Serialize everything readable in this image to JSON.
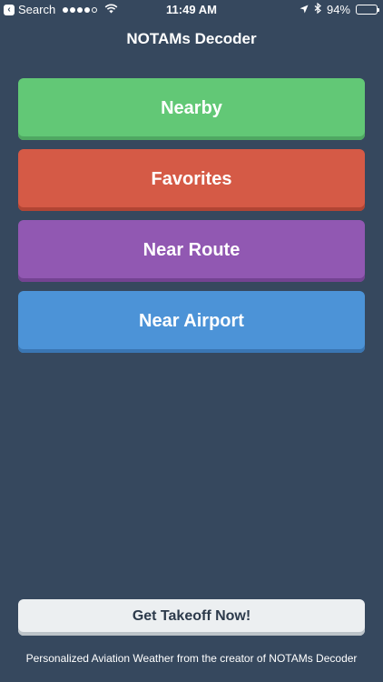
{
  "status_bar": {
    "back_label": "Search",
    "time": "11:49 AM",
    "battery": "94%",
    "battery_level": 0.94,
    "signal_bars_filled": 4,
    "signal_bars_total": 5
  },
  "nav": {
    "title": "NOTAMs Decoder"
  },
  "menu": {
    "items": [
      {
        "label": "Nearby",
        "color": "#62c876"
      },
      {
        "label": "Favorites",
        "color": "#d55a46"
      },
      {
        "label": "Near Route",
        "color": "#9158b2"
      },
      {
        "label": "Near Airport",
        "color": "#4c93d7"
      }
    ]
  },
  "promo": {
    "button_label": "Get Takeoff Now!",
    "footer": "Personalized Aviation Weather from the creator of NOTAMs Decoder"
  },
  "colors": {
    "background": "#36485e"
  },
  "icons": [
    "back-icon",
    "wifi-icon",
    "location-arrow-icon",
    "bluetooth-icon",
    "battery-icon"
  ]
}
